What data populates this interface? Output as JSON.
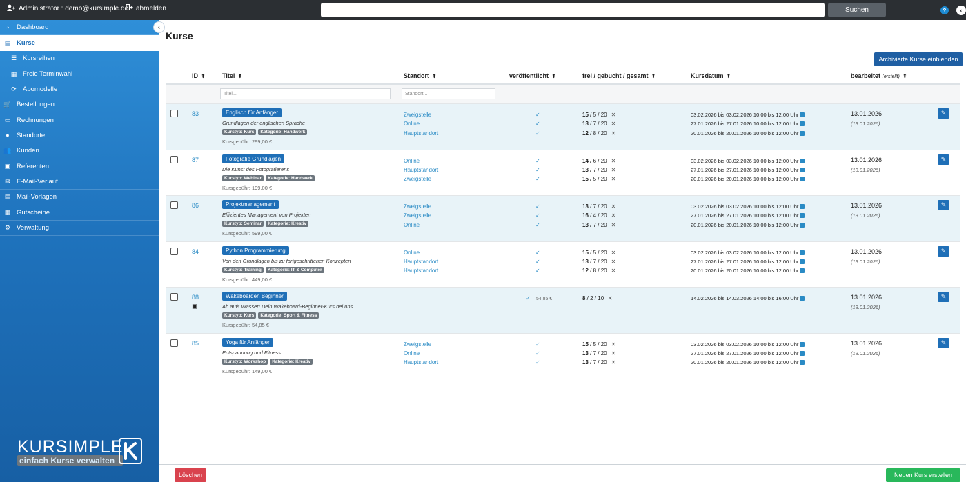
{
  "topbar": {
    "user_label": "Administrator : demo@kursimple.de",
    "logout_label": "abmelden",
    "search_placeholder": "",
    "search_button": "Suchen",
    "help_icon": "?",
    "collapse_icon": "‹"
  },
  "sidebar": {
    "items": [
      {
        "label": "Dashboard",
        "icon": "dashboard-icon"
      },
      {
        "label": "Kurse",
        "icon": "book-icon",
        "active": true
      },
      {
        "label": "Kursreihen",
        "icon": "list-icon",
        "sub": true
      },
      {
        "label": "Freie Terminwahl",
        "icon": "calendar-icon",
        "sub": true
      },
      {
        "label": "Abomodelle",
        "icon": "sync-icon",
        "sub": true
      },
      {
        "label": "Bestellungen",
        "icon": "cart-icon"
      },
      {
        "label": "Rechnungen",
        "icon": "invoice-icon"
      },
      {
        "label": "Standorte",
        "icon": "location-icon"
      },
      {
        "label": "Kunden",
        "icon": "users-icon"
      },
      {
        "label": "Referenten",
        "icon": "teacher-icon"
      },
      {
        "label": "E-Mail-Verlauf",
        "icon": "mail-icon"
      },
      {
        "label": "Mail-Vorlagen",
        "icon": "template-icon"
      },
      {
        "label": "Gutscheine",
        "icon": "gift-icon"
      },
      {
        "label": "Verwaltung",
        "icon": "gear-icon"
      }
    ],
    "logo_name": "KURSIMPLE",
    "logo_tagline": "einfach Kurse verwalten"
  },
  "main": {
    "title": "Kurse",
    "archive_button": "Archivierte Kurse einblenden",
    "headers": {
      "id": "ID",
      "title": "Titel",
      "location": "Standort",
      "published": "veröffentlicht",
      "capacity": "frei / gebucht / gesamt",
      "date": "Kursdatum",
      "edited": "bearbeitet",
      "edited_sub": "(erstellt)"
    },
    "filters": {
      "title_placeholder": "Titel...",
      "location_placeholder": "Standort..."
    },
    "rows": [
      {
        "id": "83",
        "title": "Englisch für Anfänger",
        "subtitle": "Grundlagen der englischen Sprache",
        "tags": [
          "Kurstyp: Kurs",
          "Kategorie: Handwerk"
        ],
        "fee": "Kursgebühr: 299,00 €",
        "locations": [
          "Zweigstelle",
          "Online",
          "Hauptstandort"
        ],
        "capacity": [
          [
            "15",
            "5",
            "20"
          ],
          [
            "13",
            "7",
            "20"
          ],
          [
            "12",
            "8",
            "20"
          ]
        ],
        "dates": [
          "03.02.2026 bis 03.02.2026 10:00 bis 12:00 Uhr",
          "27.01.2026 bis 27.01.2026 10:00 bis 12:00 Uhr",
          "20.01.2026 bis 20.01.2026 10:00 bis 12:00 Uhr"
        ],
        "edited": "13.01.2026",
        "created": "(13.01.2026)"
      },
      {
        "id": "87",
        "title": "Fotografie Grundlagen",
        "subtitle": "Die Kunst des Fotografierens",
        "tags": [
          "Kurstyp: Webinar",
          "Kategorie: Handwerk"
        ],
        "fee": "Kursgebühr: 199,00 €",
        "locations": [
          "Online",
          "Hauptstandort",
          "Zweigstelle"
        ],
        "capacity": [
          [
            "14",
            "6",
            "20"
          ],
          [
            "13",
            "7",
            "20"
          ],
          [
            "15",
            "5",
            "20"
          ]
        ],
        "dates": [
          "03.02.2026 bis 03.02.2026 10:00 bis 12:00 Uhr",
          "27.01.2026 bis 27.01.2026 10:00 bis 12:00 Uhr",
          "20.01.2026 bis 20.01.2026 10:00 bis 12:00 Uhr"
        ],
        "edited": "13.01.2026",
        "created": "(13.01.2026)"
      },
      {
        "id": "86",
        "title": "Projektmanagement",
        "subtitle": "Effizientes Management von Projekten",
        "tags": [
          "Kurstyp: Seminar",
          "Kategorie: Kreativ"
        ],
        "fee": "Kursgebühr: 599,00 €",
        "locations": [
          "Zweigstelle",
          "Zweigstelle",
          "Online"
        ],
        "capacity": [
          [
            "13",
            "7",
            "20"
          ],
          [
            "16",
            "4",
            "20"
          ],
          [
            "13",
            "7",
            "20"
          ]
        ],
        "dates": [
          "03.02.2026 bis 03.02.2026 10:00 bis 12:00 Uhr",
          "27.01.2026 bis 27.01.2026 10:00 bis 12:00 Uhr",
          "20.01.2026 bis 20.01.2026 10:00 bis 12:00 Uhr"
        ],
        "edited": "13.01.2026",
        "created": "(13.01.2026)"
      },
      {
        "id": "84",
        "title": "Python Programmierung",
        "subtitle": "Von den Grundlagen bis zu fortgeschrittenen Konzepten",
        "tags": [
          "Kurstyp: Training",
          "Kategorie: IT & Computer"
        ],
        "fee": "Kursgebühr: 449,00 €",
        "locations": [
          "Online",
          "Hauptstandort",
          "Hauptstandort"
        ],
        "capacity": [
          [
            "15",
            "5",
            "20"
          ],
          [
            "13",
            "7",
            "20"
          ],
          [
            "12",
            "8",
            "20"
          ]
        ],
        "dates": [
          "03.02.2026 bis 03.02.2026 10:00 bis 12:00 Uhr",
          "27.01.2026 bis 27.01.2026 10:00 bis 12:00 Uhr",
          "20.01.2026 bis 20.01.2026 10:00 bis 12:00 Uhr"
        ],
        "edited": "13.01.2026",
        "created": "(13.01.2026)"
      },
      {
        "id": "88",
        "title": "Wakeboarden Beginner",
        "subtitle": "Ab aufs Wasser! Dein Wakeboard-Beginner-Kurs bei uns",
        "tags": [
          "Kurstyp: Kurs",
          "Kategorie: Sport & Fitness"
        ],
        "fee": "Kursgebühr: 54,85 €",
        "locations": [],
        "price_note": "54,85 €",
        "capacity": [
          [
            "8",
            "2",
            "10"
          ]
        ],
        "dates": [
          "14.02.2026 bis 14.03.2026 14:00 bis 16:00 Uhr"
        ],
        "edited": "13.01.2026",
        "created": "(13.01.2026)",
        "voucher": true
      },
      {
        "id": "85",
        "title": "Yoga für Anfänger",
        "subtitle": "Entspannung und Fitness",
        "tags": [
          "Kurstyp: Workshop",
          "Kategorie: Kreativ"
        ],
        "fee": "Kursgebühr: 149,00 €",
        "locations": [
          "Zweigstelle",
          "Online",
          "Hauptstandort"
        ],
        "capacity": [
          [
            "15",
            "5",
            "20"
          ],
          [
            "13",
            "7",
            "20"
          ],
          [
            "13",
            "7",
            "20"
          ]
        ],
        "dates": [
          "03.02.2026 bis 03.02.2026 10:00 bis 12:00 Uhr",
          "27.01.2026 bis 27.01.2026 10:00 bis 12:00 Uhr",
          "20.01.2026 bis 20.01.2026 10:00 bis 12:00 Uhr"
        ],
        "edited": "13.01.2026",
        "created": "(13.01.2026)"
      }
    ],
    "footer": {
      "delete_button": "Löschen",
      "new_button": "Neuen Kurs erstellen"
    }
  },
  "colors": {
    "accent": "#1f6fb7",
    "link": "#2a8bc5",
    "danger": "#d9434e",
    "success": "#29b85b",
    "topbar": "#2b2f33"
  }
}
